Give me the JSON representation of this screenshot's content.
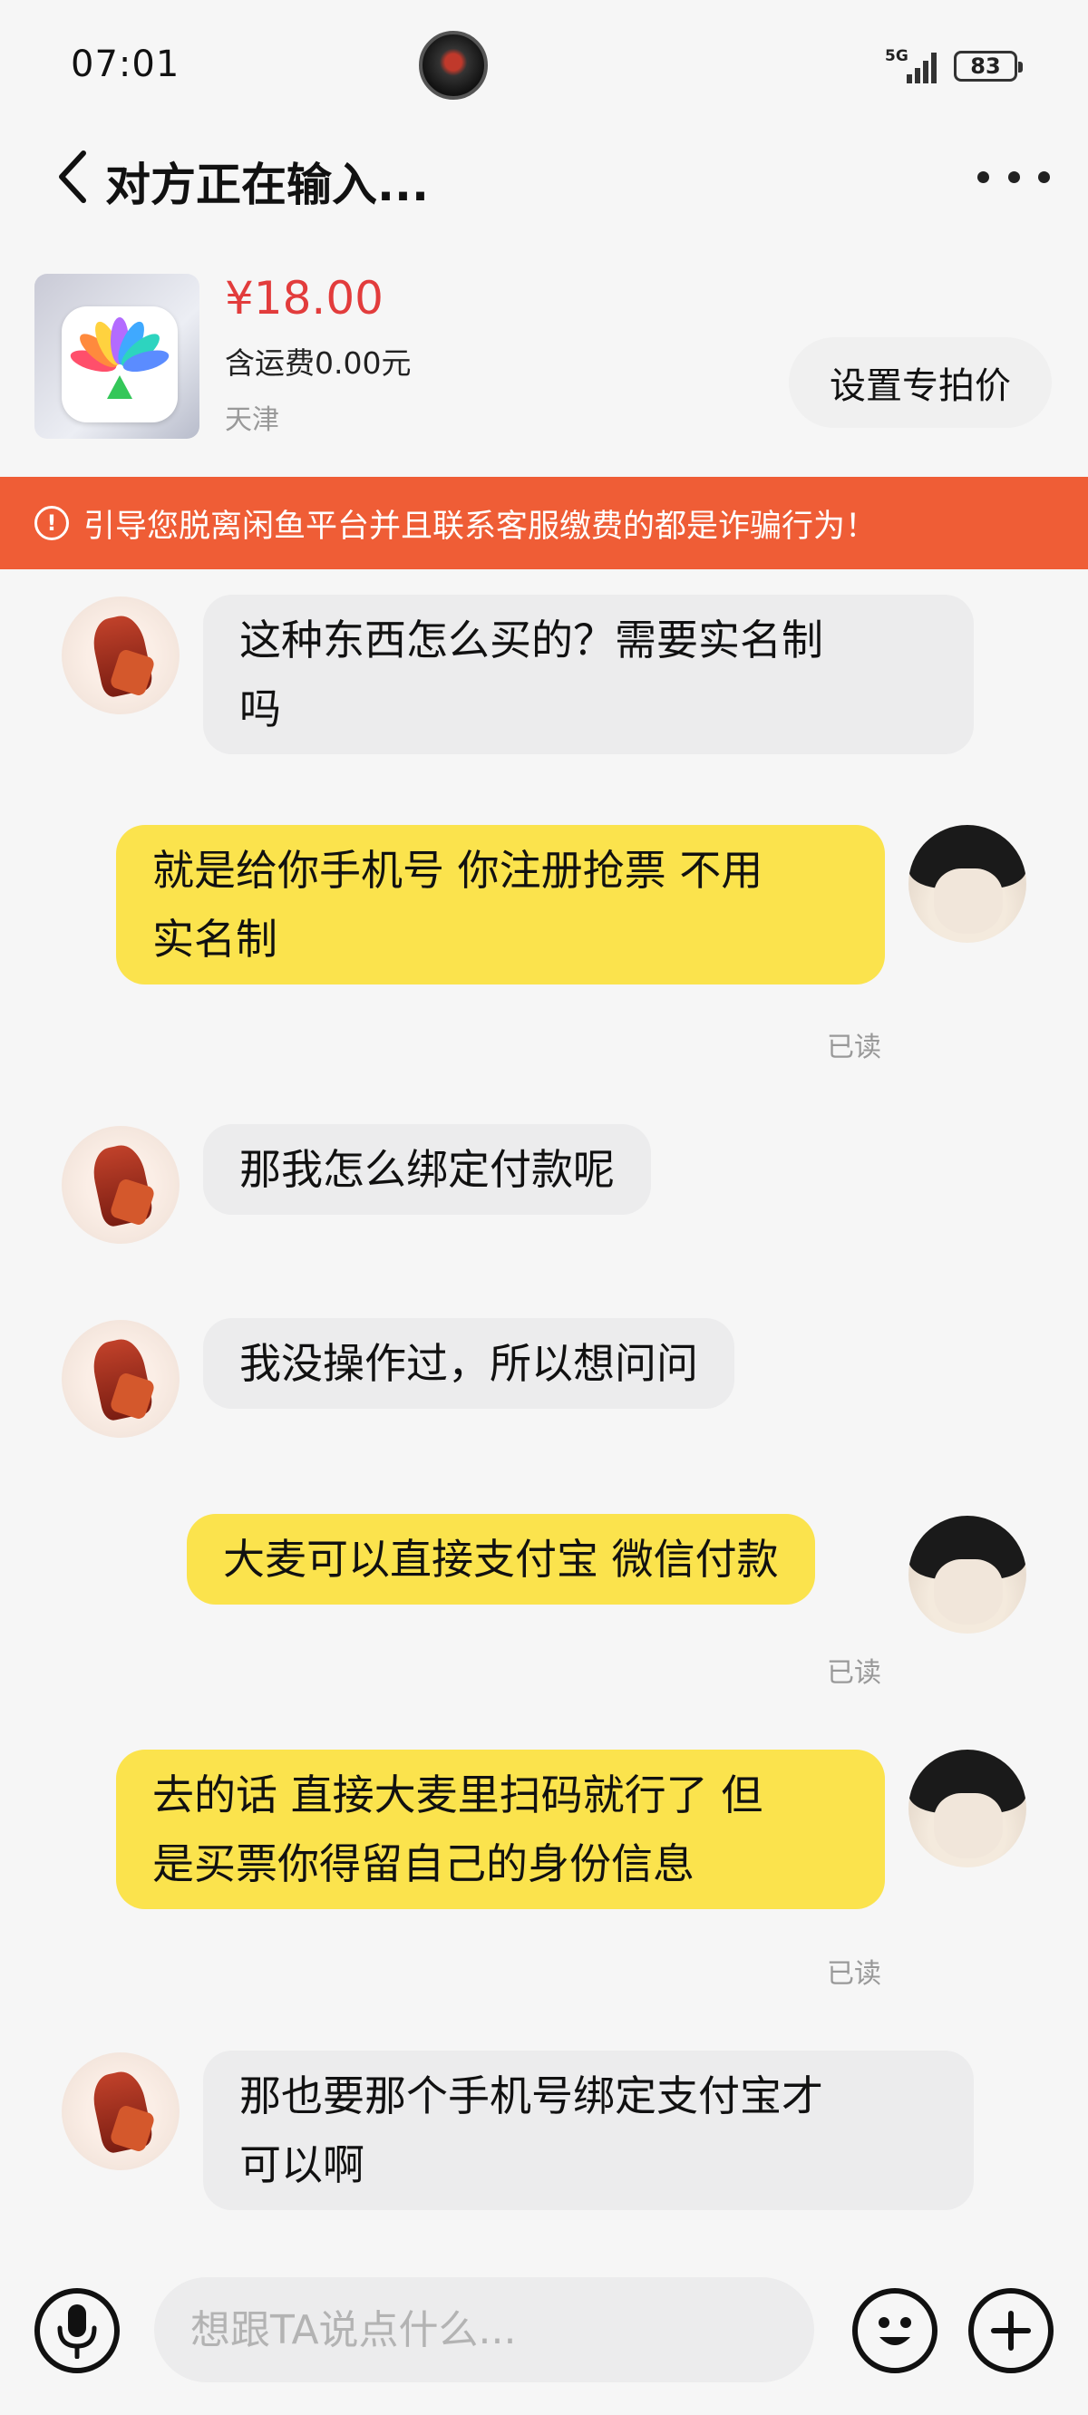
{
  "status_bar": {
    "time": "07:01",
    "network": "5G",
    "battery": "83"
  },
  "header": {
    "title": "对方正在输入..."
  },
  "product": {
    "price": "¥18.00",
    "shipping": "含运费0.00元",
    "location": "天津",
    "set_price_label": "设置专拍价"
  },
  "warning": {
    "text": "引导您脱离闲鱼平台并且联系客服缴费的都是诈骗行为！"
  },
  "messages": [
    {
      "side": "in",
      "text_lines": [
        "这种东西怎么买的？需要实名制",
        "吗"
      ]
    },
    {
      "side": "out",
      "text_lines": [
        "就是给你手机号 你注册抢票 不用",
        "实名制"
      ],
      "status": "已读"
    },
    {
      "side": "in",
      "text_lines": [
        "那我怎么绑定付款呢"
      ]
    },
    {
      "side": "in",
      "text_lines": [
        "我没操作过，所以想问问"
      ]
    },
    {
      "side": "out",
      "text_lines": [
        "大麦可以直接支付宝 微信付款"
      ],
      "status": "已读"
    },
    {
      "side": "out",
      "text_lines": [
        "去的话 直接大麦里扫码就行了 但",
        "是买票你得留自己的身份信息"
      ],
      "status": "已读"
    },
    {
      "side": "in",
      "text_lines": [
        "那也要那个手机号绑定支付宝才",
        "可以啊"
      ]
    }
  ],
  "input": {
    "placeholder": "想跟TA说点什么..."
  },
  "colors": {
    "warning_bg": "#ef5d36",
    "outgoing_bubble": "#fbe34d",
    "incoming_bubble": "#ececed",
    "price": "#e23c3c"
  }
}
